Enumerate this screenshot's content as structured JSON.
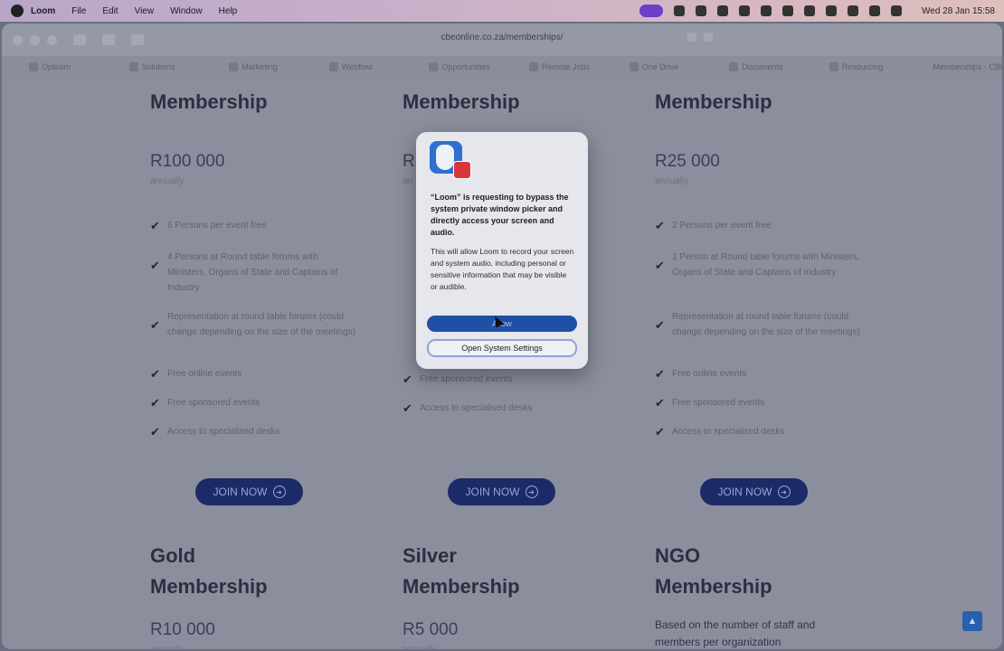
{
  "menubar": {
    "app": "Loom",
    "items": [
      "File",
      "Edit",
      "View",
      "Window",
      "Help"
    ],
    "clock": "Wed 28 Jan 15:58"
  },
  "browser": {
    "url": "cbeonline.co.za/memberships/",
    "tabs": [
      "Opteam",
      "Solutions",
      "Marketing",
      "Webflow",
      "Opportunities",
      "Remote Jobs",
      "One Drive",
      "Documents",
      "Resourcing",
      "Memberships - CBE"
    ]
  },
  "cards_top": [
    {
      "title": "Membership",
      "price": "R100 000",
      "period": "annually",
      "features": [
        "6 Persons per event free",
        "4 Persons at Round table forums with Ministers, Organs of State and Captains of Industry",
        "Representation at round table forums (could change depending on the size of the meetings)",
        "Free online events",
        "Free sponsored events",
        "Access to specialised desks"
      ],
      "button": "JOIN NOW"
    },
    {
      "title": "Membership",
      "price": "R",
      "period": "an",
      "features": [
        "",
        "",
        "",
        "",
        "Free sponsored events",
        "Access to specialised desks"
      ],
      "button": "JOIN NOW"
    },
    {
      "title": "Membership",
      "price": "R25 000",
      "period": "annually",
      "features": [
        "2 Persons per event free",
        "1 Person at Round table forums with Ministers, Organs of State and Captains of Industry",
        "Representation at round table forums (could change depending on the size of the meetings)",
        "Free online events",
        "Free sponsored events",
        "Access to specialised desks"
      ],
      "button": "JOIN NOW"
    }
  ],
  "cards_bottom": [
    {
      "line1": "Gold",
      "line2": "Membership",
      "price": "R10 000",
      "period": "annually"
    },
    {
      "line1": "Silver",
      "line2": "Membership",
      "price": "R5 000",
      "period": "annually"
    },
    {
      "line1": "NGO",
      "line2": "Membership",
      "note": "Based on the number of staff and members per organization"
    }
  ],
  "dialog": {
    "title": "“Loom” is requesting to bypass the system private window picker and directly access your screen and audio.",
    "body": "This will allow Loom to record your screen and system audio, including personal or sensitive information that may be visible or audible.",
    "allow": "Allow",
    "settings": "Open System Settings"
  },
  "colors": {
    "join_button": "#1d2a68",
    "allow_button": "#1f4fa6",
    "menubar_accent": "#6d3ec9"
  }
}
